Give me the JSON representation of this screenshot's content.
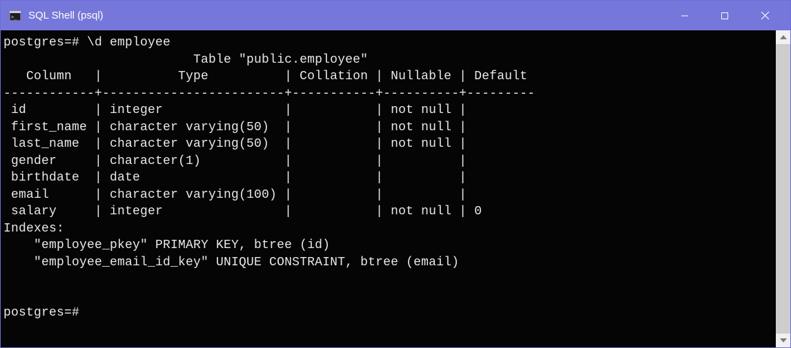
{
  "window": {
    "title": "SQL Shell (psql)"
  },
  "console": {
    "prompt_cmd": "postgres=# \\d employee",
    "table_title": "                         Table \"public.employee\"",
    "header_row": "   Column   |          Type          | Collation | Nullable | Default",
    "divider_row": "------------+------------------------+-----------+----------+---------",
    "rows": [
      " id         | integer                |           | not null |",
      " first_name | character varying(50)  |           | not null |",
      " last_name  | character varying(50)  |           | not null |",
      " gender     | character(1)           |           |          |",
      " birthdate  | date                   |           |          |",
      " email      | character varying(100) |           |          |",
      " salary     | integer                |           | not null | 0"
    ],
    "indexes_label": "Indexes:",
    "idx1": "    \"employee_pkey\" PRIMARY KEY, btree (id)",
    "idx2": "    \"employee_email_id_key\" UNIQUE CONSTRAINT, btree (email)",
    "blank": "",
    "prompt_empty": "postgres=#"
  }
}
